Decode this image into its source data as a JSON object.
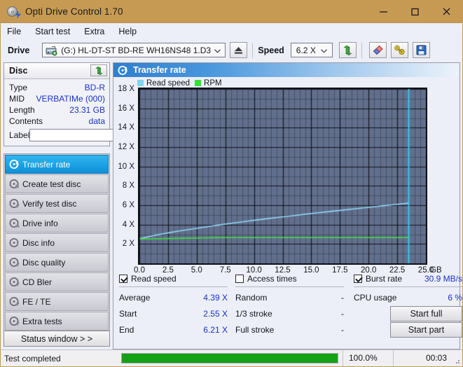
{
  "window": {
    "title": "Opti Drive Control 1.70",
    "icon": "disc-bolt-icon",
    "minimize": "minimize-icon",
    "maximize": "maximize-icon",
    "close": "close-icon",
    "titlebar_color": "#c79a54"
  },
  "menu": {
    "items": [
      {
        "label": "File"
      },
      {
        "label": "Start test"
      },
      {
        "label": "Extra"
      },
      {
        "label": "Help"
      }
    ]
  },
  "toolbar": {
    "drive_label": "Drive",
    "drive_value": "(G:)  HL-DT-ST BD-RE  WH16NS48 1.D3",
    "eject_icon": "eject-icon",
    "speed_label": "Speed",
    "speed_value": "6.2 X",
    "refresh_icon": "refresh-arrows-icon",
    "erase_icon": "eraser-icon",
    "tools_icon": "gold-tools-icon",
    "save_icon": "floppy-save-icon"
  },
  "disc": {
    "header": "Disc",
    "refresh_icon": "refresh-arrows-icon",
    "rows": [
      {
        "key": "Type",
        "value": "BD-R"
      },
      {
        "key": "MID",
        "value": "VERBATIMe (000)"
      },
      {
        "key": "Length",
        "value": "23.31 GB"
      },
      {
        "key": "Contents",
        "value": "data"
      }
    ],
    "label_key": "Label",
    "label_value": "",
    "label_placeholder": "",
    "label_button_icon": "disc-icon"
  },
  "nav": {
    "items": [
      {
        "label": "Transfer rate",
        "icon": "disc-transfer-icon",
        "selected": true
      },
      {
        "label": "Create test disc",
        "icon": "disc-create-icon",
        "selected": false
      },
      {
        "label": "Verify test disc",
        "icon": "disc-verify-icon",
        "selected": false
      },
      {
        "label": "Drive info",
        "icon": "disc-drive-icon",
        "selected": false
      },
      {
        "label": "Disc info",
        "icon": "disc-info-icon",
        "selected": false
      },
      {
        "label": "Disc quality",
        "icon": "disc-quality-icon",
        "selected": false
      },
      {
        "label": "CD Bler",
        "icon": "disc-bler-icon",
        "selected": false
      },
      {
        "label": "FE / TE",
        "icon": "disc-fete-icon",
        "selected": false
      },
      {
        "label": "Extra tests",
        "icon": "disc-extra-icon",
        "selected": false
      }
    ],
    "status_window_button": "Status window > >"
  },
  "panel": {
    "title": "Transfer rate",
    "icon": "disc-transfer-icon"
  },
  "chart_data": {
    "type": "line",
    "title": "Transfer rate",
    "xlabel": "GB",
    "ylabel": "X",
    "xlim": [
      0.0,
      25.0
    ],
    "ylim": [
      0,
      18
    ],
    "xticks": [
      "0.0",
      "2.5",
      "5.0",
      "7.5",
      "10.0",
      "12.5",
      "15.0",
      "17.5",
      "20.0",
      "22.5",
      "25.0"
    ],
    "xtick_values": [
      0.0,
      2.5,
      5.0,
      7.5,
      10.0,
      12.5,
      15.0,
      17.5,
      20.0,
      22.5,
      25.0
    ],
    "yticks": [
      "2 X",
      "4 X",
      "6 X",
      "8 X",
      "10 X",
      "12 X",
      "14 X",
      "16 X",
      "18 X"
    ],
    "ytick_values": [
      2,
      4,
      6,
      8,
      10,
      12,
      14,
      16,
      18
    ],
    "x_unit": "GB",
    "grid": true,
    "plot_bg": "#626f8c",
    "legend_position": "top-left",
    "legend": [
      {
        "name": "Read speed",
        "color": "#7fd4f2"
      },
      {
        "name": "RPM",
        "color": "#38e038"
      }
    ],
    "marker_line": {
      "x": 23.5,
      "color": "#35c8ee"
    },
    "series": [
      {
        "name": "Read speed",
        "color": "#8fd8f5",
        "x": [
          0.05,
          0.6,
          1.3,
          2.0,
          2.8,
          3.6,
          4.5,
          5.4,
          6.3,
          7.2,
          8.2,
          9.2,
          10.2,
          11.2,
          12.3,
          13.4,
          14.5,
          15.6,
          16.7,
          17.8,
          18.9,
          20.0,
          21.1,
          22.2,
          23.3,
          23.5
        ],
        "y": [
          2.55,
          2.7,
          2.88,
          3.04,
          3.21,
          3.36,
          3.53,
          3.69,
          3.85,
          4.0,
          4.16,
          4.32,
          4.47,
          4.62,
          4.77,
          4.92,
          5.07,
          5.22,
          5.36,
          5.5,
          5.64,
          5.78,
          5.92,
          6.05,
          6.19,
          6.21
        ]
      },
      {
        "name": "RPM",
        "color": "#3ce03c",
        "x": [
          0.05,
          1.0,
          2.5,
          4.0,
          5.5,
          6.5,
          7.5,
          10.0,
          13.0,
          16.0,
          19.0,
          22.0,
          23.5
        ],
        "y": [
          2.5,
          2.53,
          2.56,
          2.59,
          2.62,
          2.65,
          2.66,
          2.66,
          2.66,
          2.66,
          2.66,
          2.66,
          2.66
        ]
      }
    ]
  },
  "stats": {
    "read_speed": {
      "checkbox_label": "Read speed",
      "checked": true,
      "rows": [
        {
          "key": "Average",
          "value": "4.39 X"
        },
        {
          "key": "Start",
          "value": "2.55 X"
        },
        {
          "key": "End",
          "value": "6.21 X"
        }
      ]
    },
    "access_times": {
      "checkbox_label": "Access times",
      "checked": false,
      "rows": [
        {
          "key": "Random",
          "value": "-"
        },
        {
          "key": "1/3 stroke",
          "value": "-"
        },
        {
          "key": "Full stroke",
          "value": "-"
        }
      ]
    },
    "burst": {
      "checkbox_label": "Burst rate",
      "checked": true,
      "value": "30.9 MB/s",
      "cpu_key": "CPU usage",
      "cpu_value": "6 %",
      "start_full": "Start full",
      "start_part": "Start part"
    }
  },
  "statusbar": {
    "text": "Test completed",
    "progress_label": "100.0%",
    "progress_pct": 100,
    "elapsed": "00:03",
    "progress_color": "#15a115"
  }
}
